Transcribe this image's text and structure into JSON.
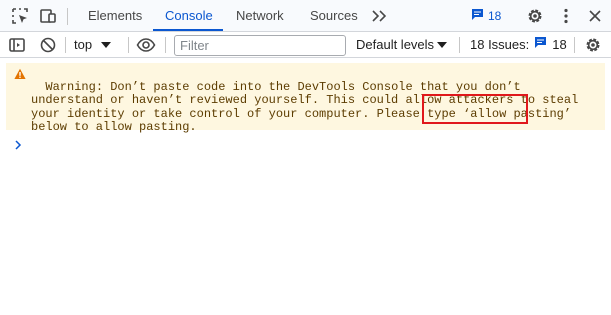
{
  "tabbar": {
    "icons": [
      "select-element-icon",
      "device-toolbar-icon",
      "more-tabs-icon",
      "settings-gear-icon",
      "more-options-icon"
    ],
    "tabs": [
      {
        "label": "Elements",
        "active": false
      },
      {
        "label": "Console",
        "active": true
      },
      {
        "label": "Network",
        "active": false
      },
      {
        "label": "Sources",
        "active": false
      }
    ],
    "issues_badge": "18"
  },
  "toolbar": {
    "icons": [
      "sidebar-toggle-icon",
      "clear-console-icon",
      "eye-icon",
      "settings-gear-icon"
    ],
    "context": "top",
    "filter_placeholder": "Filter",
    "levels_label": "Default levels",
    "issues_label": "18 Issues:",
    "issues_count": "18"
  },
  "console": {
    "warning_text": "Warning: Don’t paste code into the DevTools Console that you don’t understand or haven’t reviewed yourself. This could allow attackers to steal your identity or take control of your computer. Please type ‘allow pasting’ below to allow pasting.",
    "highlighted_phrase": "allow pasting"
  },
  "colors": {
    "accent": "#0b57d0",
    "warning_bg": "#fef7e0",
    "warning_text": "#5c3c00",
    "warning_icon": "#e37400",
    "highlight_box": "#e0181b"
  }
}
